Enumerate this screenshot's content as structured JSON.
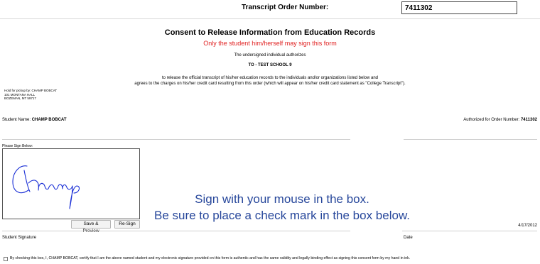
{
  "header": {
    "order_label": "Transcript Order Number:",
    "order_value": "7411302"
  },
  "document": {
    "title": "Consent to Release Information from Education Records",
    "warning": "Only the student him/herself may sign this form",
    "authorizes": "The undersigned individual authorizes",
    "school": "TO - TEST SCHOOL 9",
    "body_line1": "to release the official transcript of his/her education records to the individuals and/or organizations listed below and",
    "body_line2": "agrees to the charges on his/her credit card resulting from this order (which will appear on his/her credit card statement as \"College Transcript\")."
  },
  "pickup": {
    "line1": "Hold for pickup by: CHAMP BOBCAT",
    "line2": "101 MONTANA HALL",
    "line3": "BOZEMAN, MT 59717"
  },
  "student": {
    "name_label": "Student Name:",
    "name_value": "CHAMP BOBCAT",
    "authorized_label": "Authorized for Order Number:",
    "authorized_value": "7411302"
  },
  "signature": {
    "label": "Please Sign Below:",
    "save_button": "Save & Preview",
    "resign_button": "Re-Sign",
    "caption": "Student Signature",
    "ink_color": "#1a2fd6"
  },
  "instructions": {
    "line1": "Sign with your mouse in the box.",
    "line2": "Be sure to place a check mark in the box below.",
    "color": "#27479b"
  },
  "date": {
    "value": "4/17/2012",
    "caption": "Date"
  },
  "consent": {
    "checked": false,
    "text": "By checking this box, I, CHAMP BOBCAT, certify that I am the above named student and my electronic signature provided on this form is authentic and has the same validity and legally binding effect as signing this consent form by my hand in ink."
  }
}
